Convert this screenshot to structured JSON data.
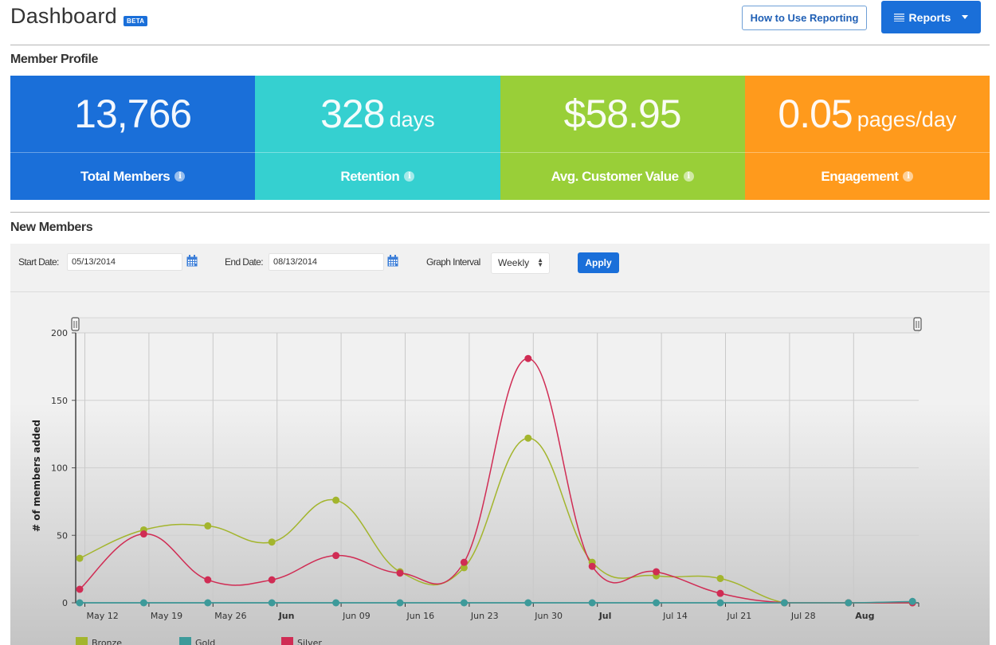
{
  "header": {
    "title": "Dashboard",
    "badge": "BETA",
    "how_to_button": "How to Use Reporting",
    "reports_button": "Reports"
  },
  "member_profile": {
    "title": "Member Profile",
    "stats": [
      {
        "value": "13,766",
        "unit": "",
        "label": "Total Members",
        "color": "#1a6fd9"
      },
      {
        "value": "328",
        "unit": "days",
        "label": "Retention",
        "color": "#35d0d0"
      },
      {
        "value": "$58.95",
        "unit": "",
        "label": "Avg. Customer Value",
        "color": "#99cf38"
      },
      {
        "value": "0.05",
        "unit": "pages/day",
        "label": "Engagement",
        "color": "#ff9a1c"
      }
    ]
  },
  "new_members": {
    "title": "New Members",
    "filters": {
      "start_label": "Start Date:",
      "start_value": "05/13/2014",
      "end_label": "End Date:",
      "end_value": "08/13/2014",
      "interval_label": "Graph Interval",
      "interval_value": "Weekly",
      "apply_button": "Apply"
    }
  },
  "chart_data": {
    "type": "line",
    "title": "",
    "xlabel": "",
    "ylabel": "# of members added",
    "ylim": [
      0,
      200
    ],
    "yticks": [
      0,
      50,
      100,
      150,
      200
    ],
    "grid": true,
    "legend": "bottom-left",
    "x_tick_labels": [
      {
        "label": "May 12",
        "bold": false
      },
      {
        "label": "May 19",
        "bold": false
      },
      {
        "label": "May 26",
        "bold": false
      },
      {
        "label": "Jun",
        "bold": true
      },
      {
        "label": "Jun 09",
        "bold": false
      },
      {
        "label": "Jun 16",
        "bold": false
      },
      {
        "label": "Jun 23",
        "bold": false
      },
      {
        "label": "Jun 30",
        "bold": false
      },
      {
        "label": "Jul",
        "bold": true
      },
      {
        "label": "Jul 14",
        "bold": false
      },
      {
        "label": "Jul 21",
        "bold": false
      },
      {
        "label": "Jul 28",
        "bold": false
      },
      {
        "label": "Aug",
        "bold": true
      }
    ],
    "x": [
      "May 11",
      "May 18",
      "May 25",
      "Jun 01",
      "Jun 08",
      "Jun 15",
      "Jun 22",
      "Jun 29",
      "Jul 06",
      "Jul 13",
      "Jul 20",
      "Jul 27",
      "Aug 03",
      "Aug 10"
    ],
    "series": [
      {
        "name": "Bronze",
        "color": "#a3b52d",
        "values": [
          33,
          54,
          57,
          45,
          76,
          23,
          26,
          122,
          30,
          20,
          18,
          0,
          0,
          0
        ]
      },
      {
        "name": "Gold",
        "color": "#3d9a9a",
        "values": [
          0,
          0,
          0,
          0,
          0,
          0,
          0,
          0,
          0,
          0,
          0,
          0,
          0,
          1
        ]
      },
      {
        "name": "Silver",
        "color": "#d02c54",
        "values": [
          10,
          51,
          17,
          17,
          35,
          22,
          30,
          181,
          27,
          23,
          7,
          0,
          0,
          0
        ]
      }
    ]
  }
}
